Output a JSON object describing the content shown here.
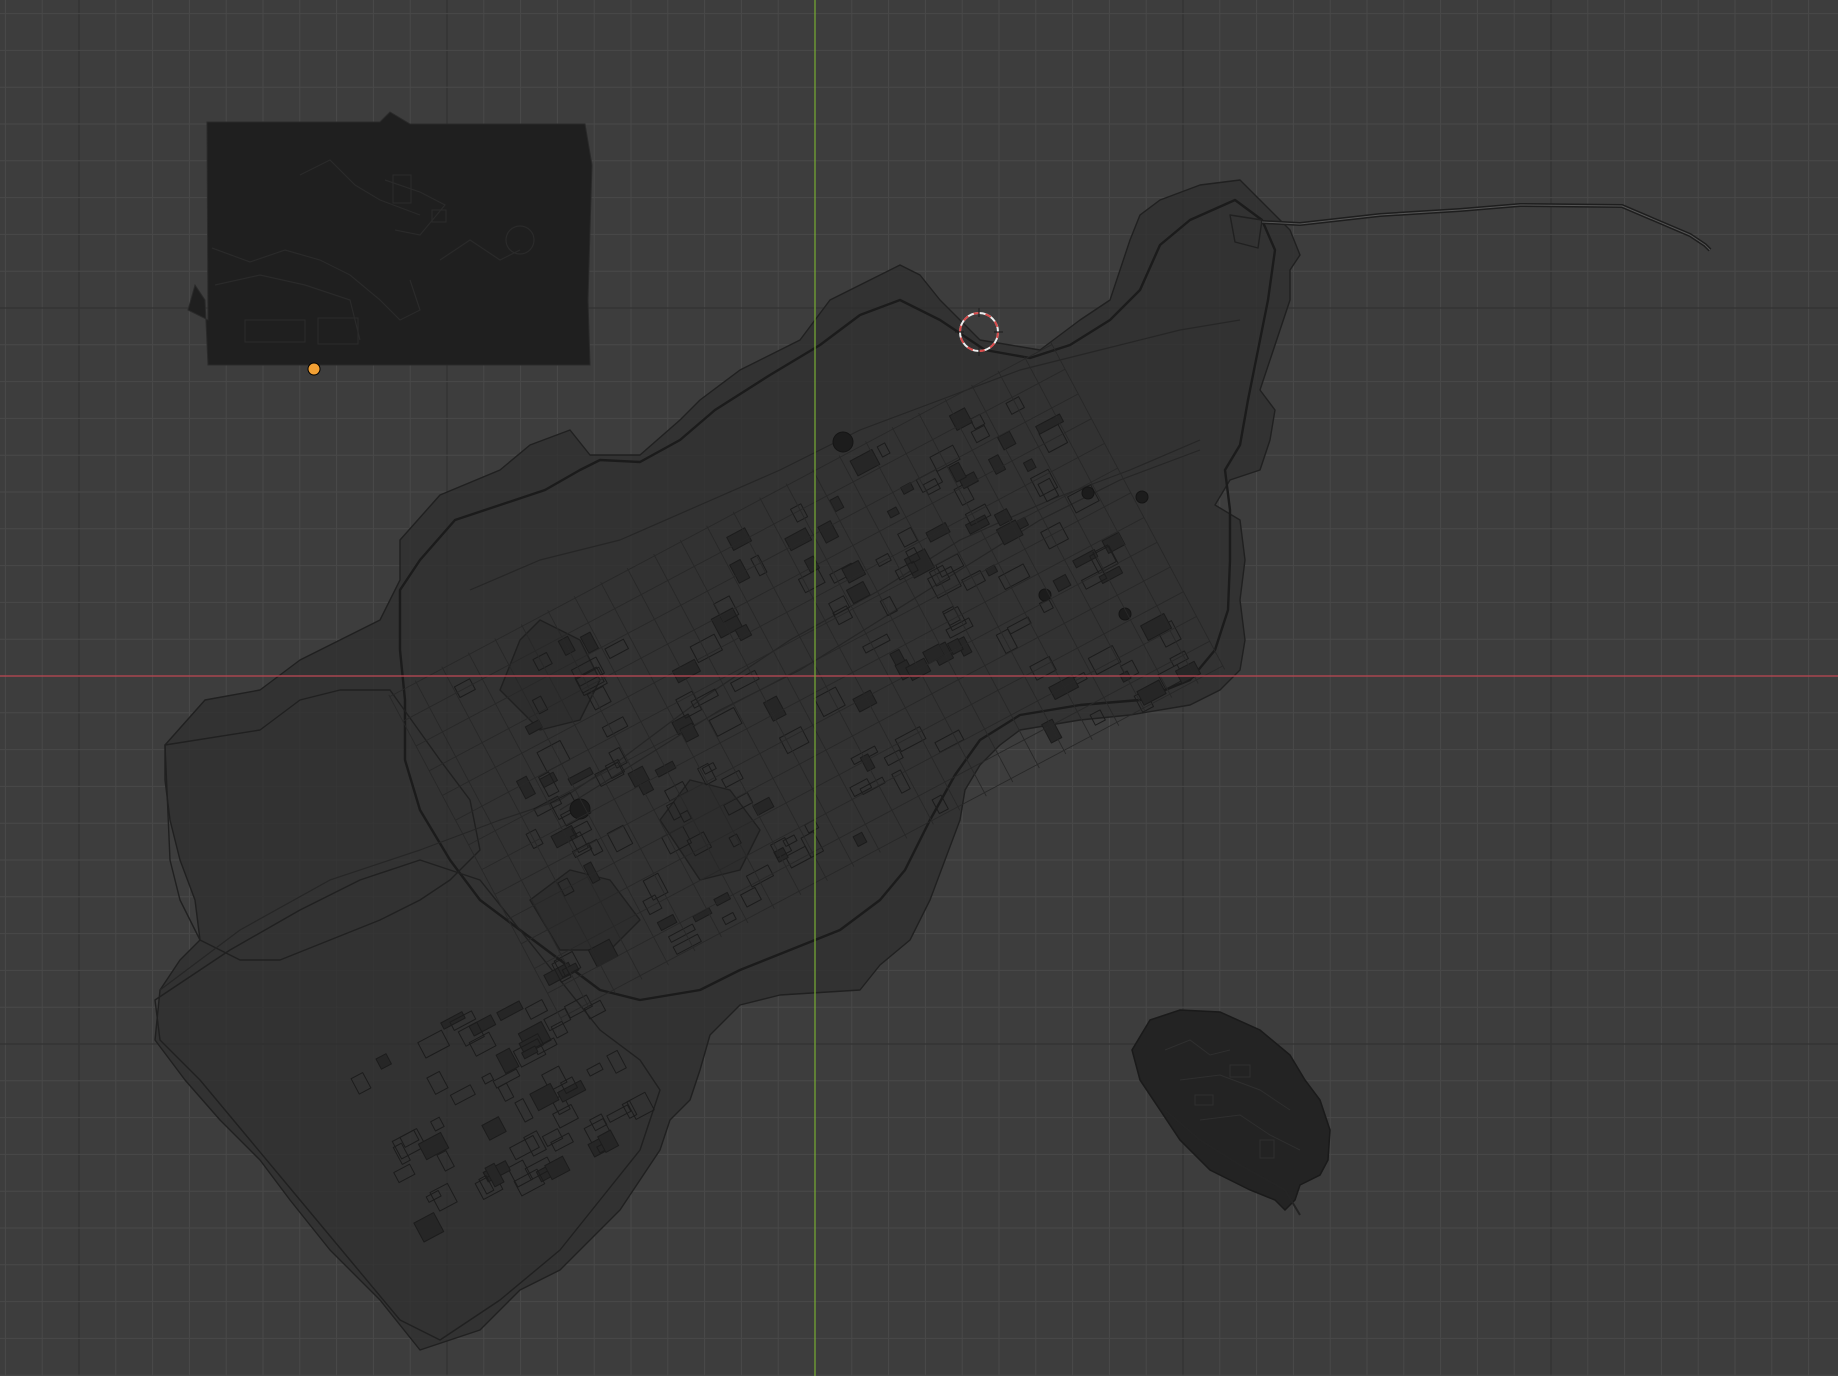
{
  "viewport": {
    "background_color": "#3d3d3d",
    "grid_minor_color": "#494949",
    "grid_major_color": "#333333",
    "x_axis_color": "#c04a56",
    "y_axis_color": "#74a535",
    "wire_color": "#202020",
    "mesh_fill_color": "#1f1f1f",
    "island_fill_color": "#232323"
  },
  "scene_objects": {
    "city_wireframe": {
      "type": "wireframe-mesh"
    },
    "terrain_tile": {
      "type": "solid-mesh"
    },
    "island": {
      "type": "solid-mesh"
    },
    "pier": {
      "type": "wireframe-mesh"
    },
    "origin_marker": {
      "icon": "object-origin-icon",
      "color": "#f2a034"
    },
    "cursor_3d": {
      "icon": "3d-cursor-icon",
      "color_a": "#d94a4a",
      "color_b": "#eeeeee"
    }
  }
}
